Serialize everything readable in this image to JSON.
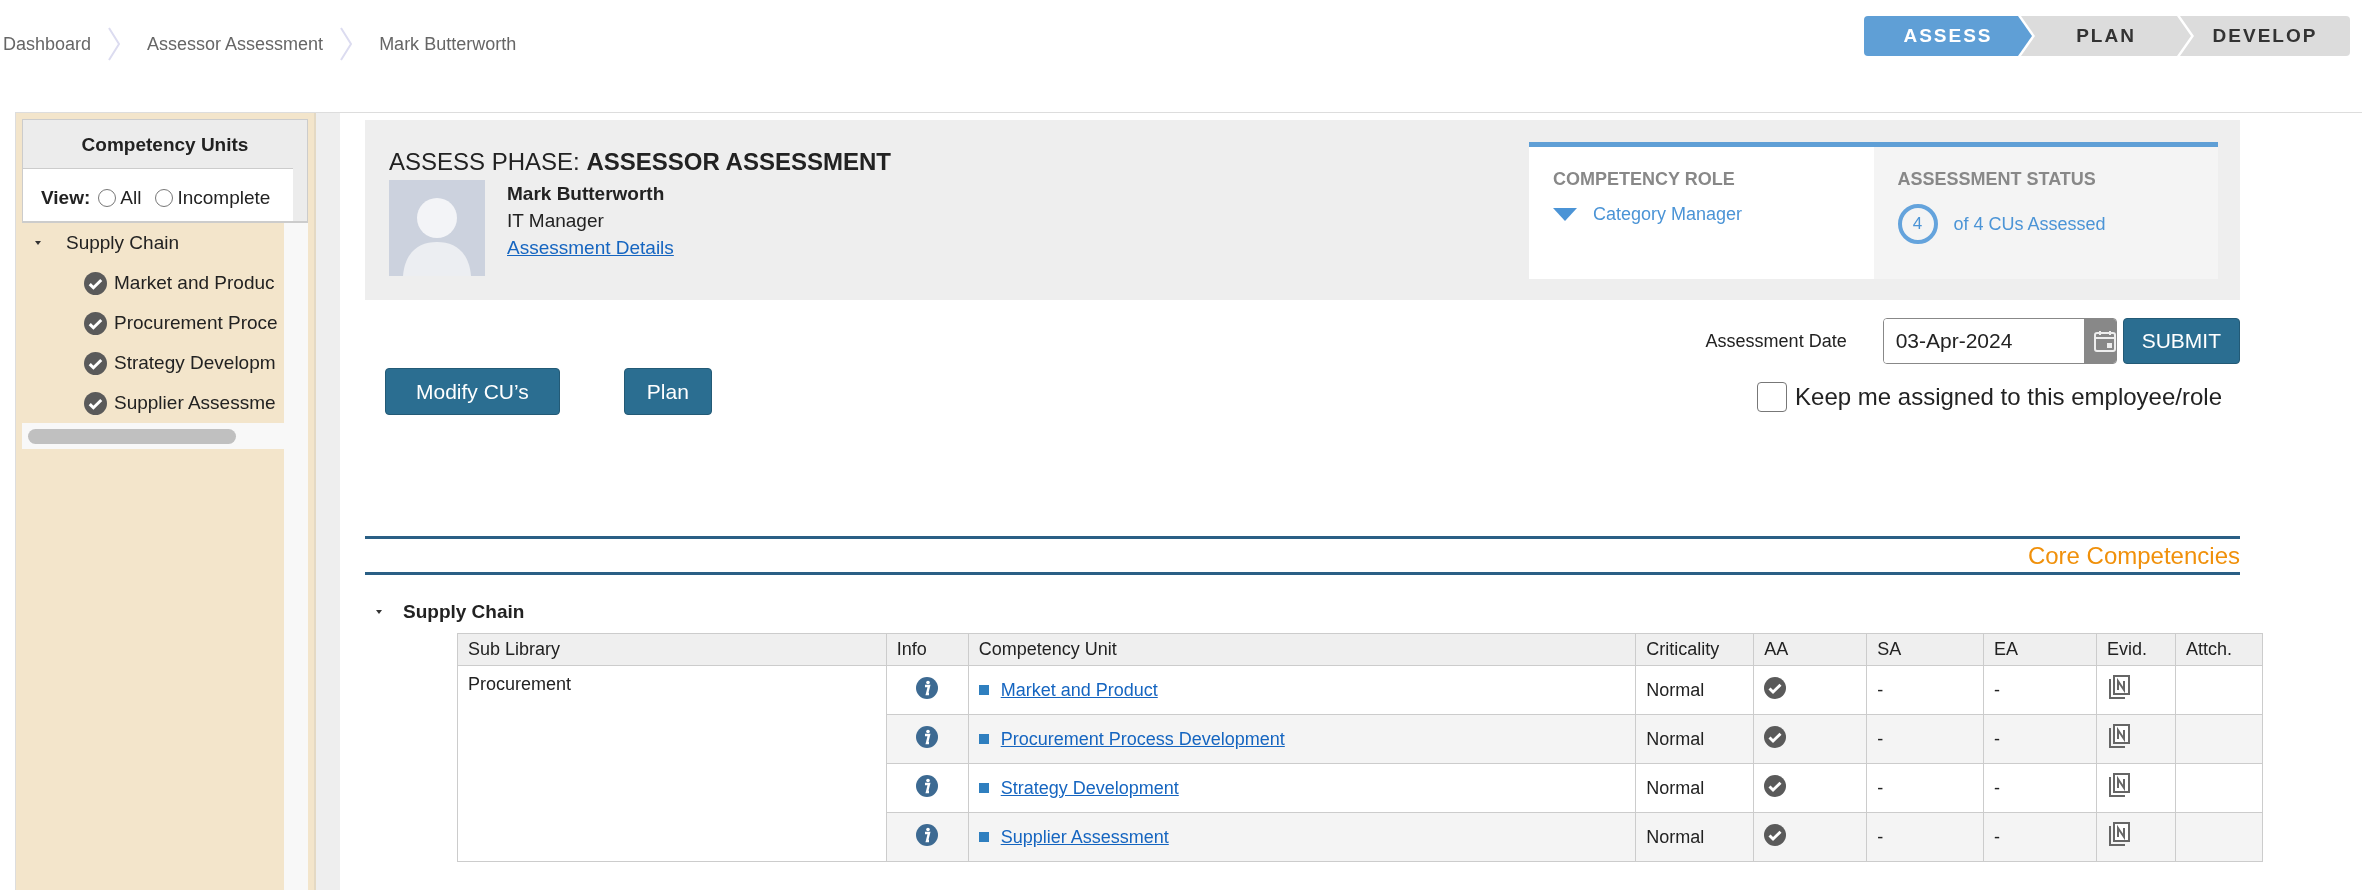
{
  "breadcrumb": [
    "Dashboard",
    "Assessor Assessment",
    "Mark Butterworth"
  ],
  "steps": [
    {
      "label": "ASSESS",
      "selected": true
    },
    {
      "label": "PLAN",
      "selected": false
    },
    {
      "label": "DEVELOP",
      "selected": false
    }
  ],
  "sidebar": {
    "title": "Competency Units",
    "view_label": "View:",
    "view_options": [
      {
        "label": "All",
        "selected": false
      },
      {
        "label": "Incomplete",
        "selected": false
      }
    ],
    "tree": [
      {
        "label": "Supply Chain",
        "expanded": true,
        "children": [
          {
            "label": "Market and Produc",
            "checked": true
          },
          {
            "label": "Procurement Proce",
            "checked": true
          },
          {
            "label": "Strategy Developm",
            "checked": true
          },
          {
            "label": "Supplier Assessme",
            "checked": true
          }
        ]
      }
    ]
  },
  "header": {
    "phase_prefix": "ASSESS PHASE:",
    "phase_name": "ASSESSOR ASSESSMENT",
    "person_name": "Mark Butterworth",
    "person_role": "IT Manager",
    "details_link": "Assessment Details",
    "competency_role": {
      "heading": "COMPETENCY ROLE",
      "value": "Category Manager"
    },
    "assessment_status": {
      "heading": "ASSESSMENT STATUS",
      "count": "4",
      "text": "of 4 CUs Assessed"
    }
  },
  "assessment_date": {
    "label": "Assessment Date",
    "value": "03-Apr-2024",
    "submit": "SUBMIT"
  },
  "keep_assigned": {
    "label": "Keep me assigned to this employee/role",
    "checked": false
  },
  "buttons": [
    "Modify CU’s",
    "Plan"
  ],
  "section_title": "Core Competencies",
  "group": {
    "label": "Supply Chain",
    "expanded": true
  },
  "table": {
    "columns": [
      "Sub Library",
      "Info",
      "Competency Unit",
      "Criticality",
      "AA",
      "SA",
      "EA",
      "Evid.",
      "Attch."
    ],
    "sub_library": "Procurement",
    "rows": [
      {
        "unit": "Market and Product",
        "criticality": "Normal",
        "aa_done": true,
        "sa": "-",
        "ea": "-"
      },
      {
        "unit": "Procurement Process Development",
        "criticality": "Normal",
        "aa_done": true,
        "sa": "-",
        "ea": "-"
      },
      {
        "unit": "Strategy Development",
        "criticality": "Normal",
        "aa_done": true,
        "sa": "-",
        "ea": "-"
      },
      {
        "unit": "Supplier Assessment",
        "criticality": "Normal",
        "aa_done": true,
        "sa": "-",
        "ea": "-"
      }
    ]
  }
}
